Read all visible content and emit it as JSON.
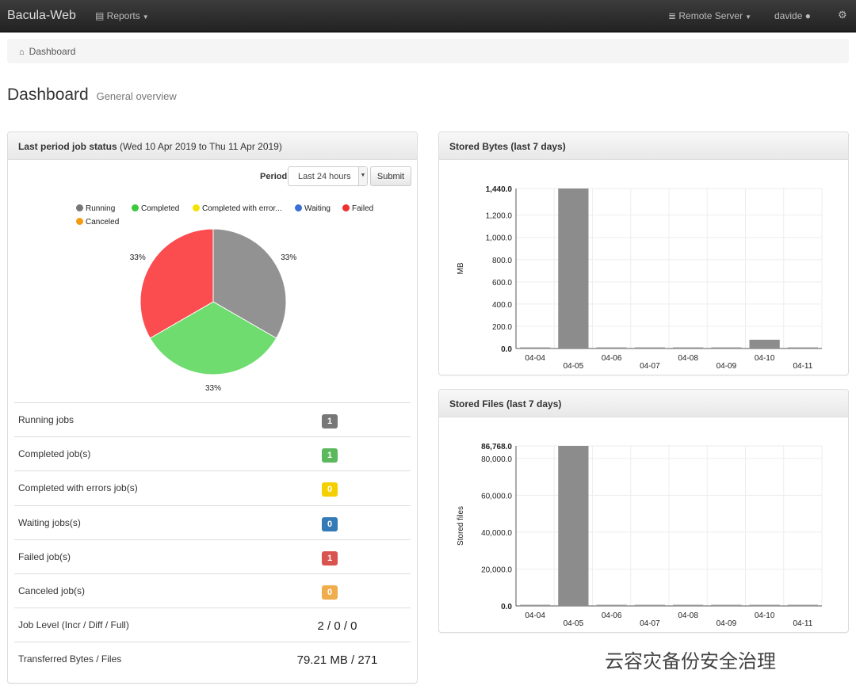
{
  "navbar": {
    "brand": "Bacula-Web",
    "reports_label": "Reports",
    "server_label": "Remote Server",
    "user_label": "davide"
  },
  "breadcrumb": {
    "label": "Dashboard"
  },
  "page": {
    "title": "Dashboard",
    "subtitle": "General overview"
  },
  "job_status": {
    "heading": "Last period job status",
    "heading_range": "(Wed 10 Apr 2019 to Thu 11 Apr 2019)",
    "period_label": "Period",
    "period_value": "Last 24 hours",
    "submit_label": "Submit",
    "legend": [
      {
        "label": "Running",
        "color": "#777777"
      },
      {
        "label": "Completed",
        "color": "#3cc93c"
      },
      {
        "label": "Completed with error...",
        "color": "#f3e300"
      },
      {
        "label": "Waiting",
        "color": "#3b6fd8"
      },
      {
        "label": "Failed",
        "color": "#f02f2f"
      },
      {
        "label": "Canceled",
        "color": "#f39c12"
      }
    ],
    "pie": {
      "slices": [
        {
          "label": "Running",
          "value": 1,
          "percent": "33%",
          "color": "#929292"
        },
        {
          "label": "Completed",
          "value": 1,
          "percent": "33%",
          "color": "#6fdc6f"
        },
        {
          "label": "Failed",
          "value": 1,
          "percent": "33%",
          "color": "#fb4c4f"
        }
      ]
    },
    "stats": [
      {
        "label": "Running jobs",
        "value": "1",
        "color": "#777777"
      },
      {
        "label": "Completed job(s)",
        "value": "1",
        "color": "#5cb85c"
      },
      {
        "label": "Completed with errors job(s)",
        "value": "0",
        "color": "#f5d000"
      },
      {
        "label": "Waiting jobs(s)",
        "value": "0",
        "color": "#337ab7"
      },
      {
        "label": "Failed job(s)",
        "value": "1",
        "color": "#d9534f"
      },
      {
        "label": "Canceled job(s)",
        "value": "0",
        "color": "#f0ad4e"
      }
    ],
    "job_level_label": "Job Level (Incr / Diff / Full)",
    "job_level_value": "2 / 0 / 0",
    "transferred_label": "Transferred Bytes / Files",
    "transferred_value": "79.21 MB / 271"
  },
  "chart_data": [
    {
      "type": "bar",
      "title": "Stored Bytes (last 7 days)",
      "ylabel": "MB",
      "categories": [
        "04-04",
        "04-05",
        "04-06",
        "04-07",
        "04-08",
        "04-09",
        "04-10",
        "04-11"
      ],
      "values": [
        0,
        1440,
        0,
        0,
        0,
        0,
        79,
        0
      ],
      "ylim": [
        0,
        1440
      ],
      "yticks": [
        "1,440.0",
        "1,200.0",
        "1,000.0",
        "800.0",
        "600.0",
        "400.0",
        "200.0",
        "0.0"
      ],
      "ytick_values": [
        1440,
        1200,
        1000,
        800,
        600,
        400,
        200,
        0
      ],
      "bar_color": "#8c8c8c",
      "grid": true
    },
    {
      "type": "bar",
      "title": "Stored Files (last 7 days)",
      "ylabel": "Stored files",
      "categories": [
        "04-04",
        "04-05",
        "04-06",
        "04-07",
        "04-08",
        "04-09",
        "04-10",
        "04-11"
      ],
      "values": [
        0,
        86768,
        0,
        0,
        0,
        0,
        0,
        0
      ],
      "ylim": [
        0,
        86768
      ],
      "yticks": [
        "86,768.0",
        "80,000.0",
        "60,000.0",
        "40,000.0",
        "20,000.0",
        "0.0"
      ],
      "ytick_values": [
        86768,
        80000,
        60000,
        40000,
        20000,
        0
      ],
      "bar_color": "#8c8c8c",
      "grid": true
    }
  ],
  "watermark": "云容灾备份安全治理"
}
